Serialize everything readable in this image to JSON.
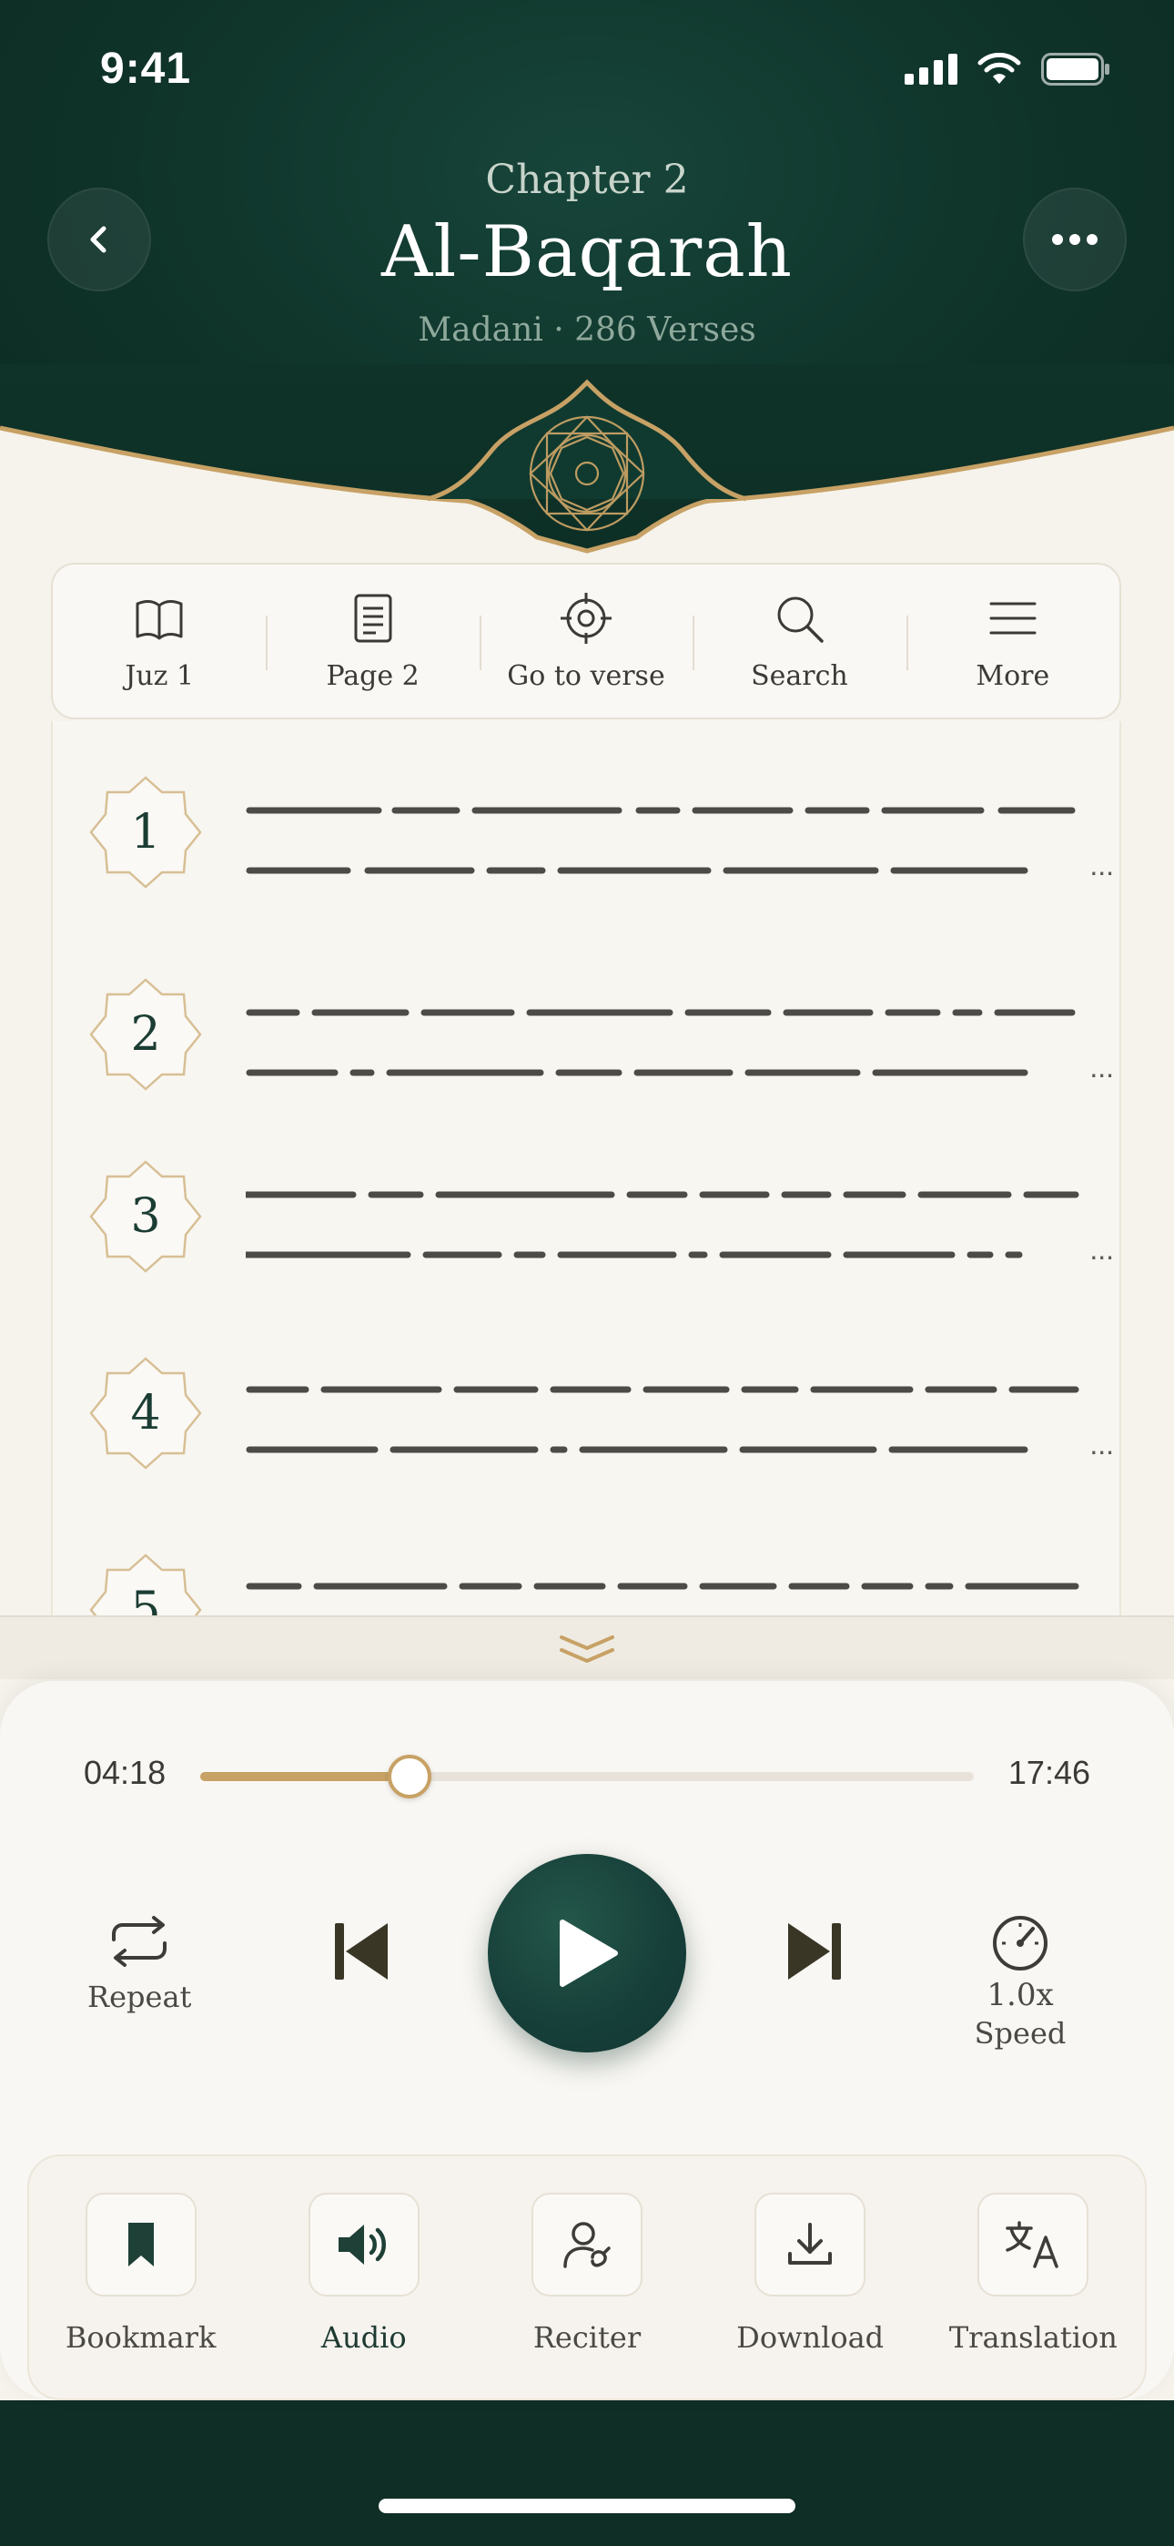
{
  "status_bar": {
    "time": "9:41"
  },
  "header": {
    "chapter_label": "Chapter 2",
    "surah_name": "Al-Baqarah",
    "meta": "Madani · 286 Verses"
  },
  "toolbar": {
    "items": [
      {
        "label": "Juz 1",
        "icon": "book-icon"
      },
      {
        "label": "Page 2",
        "icon": "page-icon"
      },
      {
        "label": "Go to verse",
        "icon": "target-icon"
      },
      {
        "label": "Search",
        "icon": "search-icon"
      },
      {
        "label": "More",
        "icon": "menu-icon"
      }
    ]
  },
  "verses": [
    {
      "number": "1",
      "ellipsis": "..."
    },
    {
      "number": "2",
      "ellipsis": "..."
    },
    {
      "number": "3",
      "ellipsis": "..."
    },
    {
      "number": "4",
      "ellipsis": "..."
    },
    {
      "number": "5",
      "ellipsis": ""
    }
  ],
  "player": {
    "current_time": "04:18",
    "total_time": "17:46",
    "progress": 0.27,
    "repeat_label": "Repeat",
    "speed_value": "1.0x",
    "speed_label": "Speed"
  },
  "actions": [
    {
      "label": "Bookmark",
      "icon": "bookmark-icon"
    },
    {
      "label": "Audio",
      "icon": "speaker-icon"
    },
    {
      "label": "Reciter",
      "icon": "reciter-icon"
    },
    {
      "label": "Download",
      "icon": "download-icon"
    },
    {
      "label": "Translation",
      "icon": "translate-icon"
    }
  ],
  "colors": {
    "header_green": "#0f3329",
    "accent_gold": "#c7a165",
    "play_green": "#17403a",
    "paper": "#f6f3ed"
  }
}
